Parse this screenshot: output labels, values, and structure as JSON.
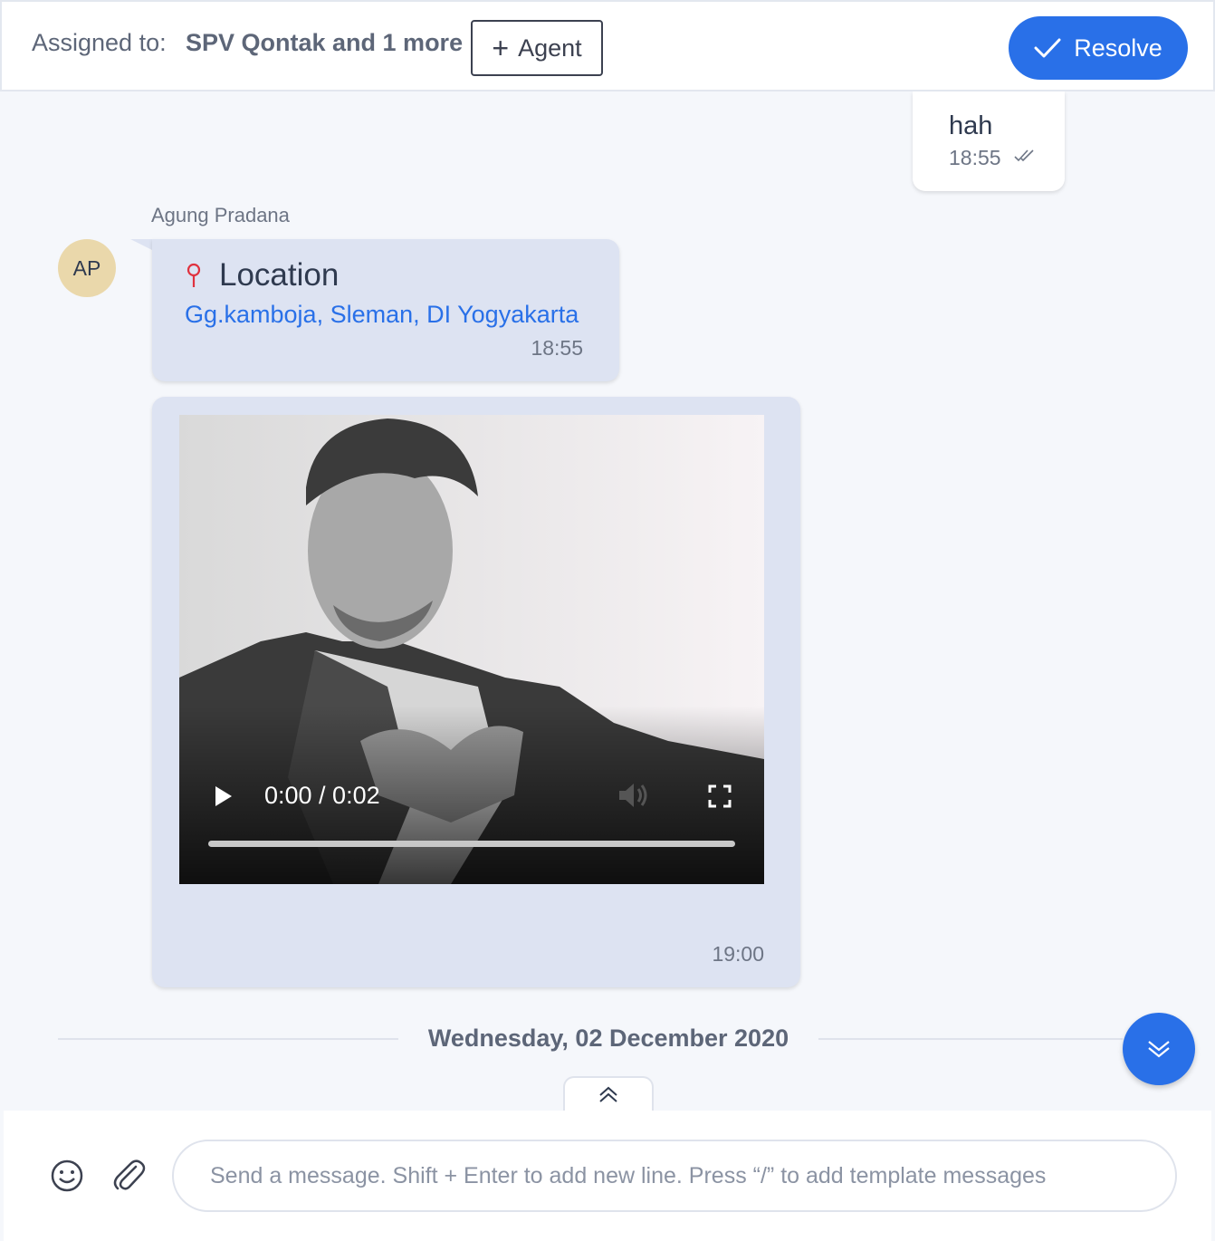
{
  "header": {
    "assigned_label": "Assigned to:",
    "assigned_value": "SPV Qontak and 1 more",
    "agent_button_label": "Agent",
    "resolve_button_label": "Resolve"
  },
  "messages": {
    "outgoing": {
      "text": "hah",
      "time": "18:55",
      "status_icon": "double-check-icon"
    },
    "sender_name": "Agung Pradana",
    "avatar_initials": "AP",
    "location": {
      "title": "Location",
      "address": "Gg.kamboja, Sleman, DI Yogyakarta",
      "time": "18:55"
    },
    "video": {
      "current_time": "0:00 / 0:02",
      "progress": 0,
      "time": "19:00"
    }
  },
  "date_separator": "Wednesday, 02 December 2020",
  "composer": {
    "placeholder": "Send a message. Shift + Enter to add new line. Press “/” to add template messages"
  },
  "colors": {
    "accent": "#2970e8",
    "incoming_bubble": "#dde3f2",
    "avatar": "#ead8ab",
    "location_pin": "#e0323f"
  }
}
